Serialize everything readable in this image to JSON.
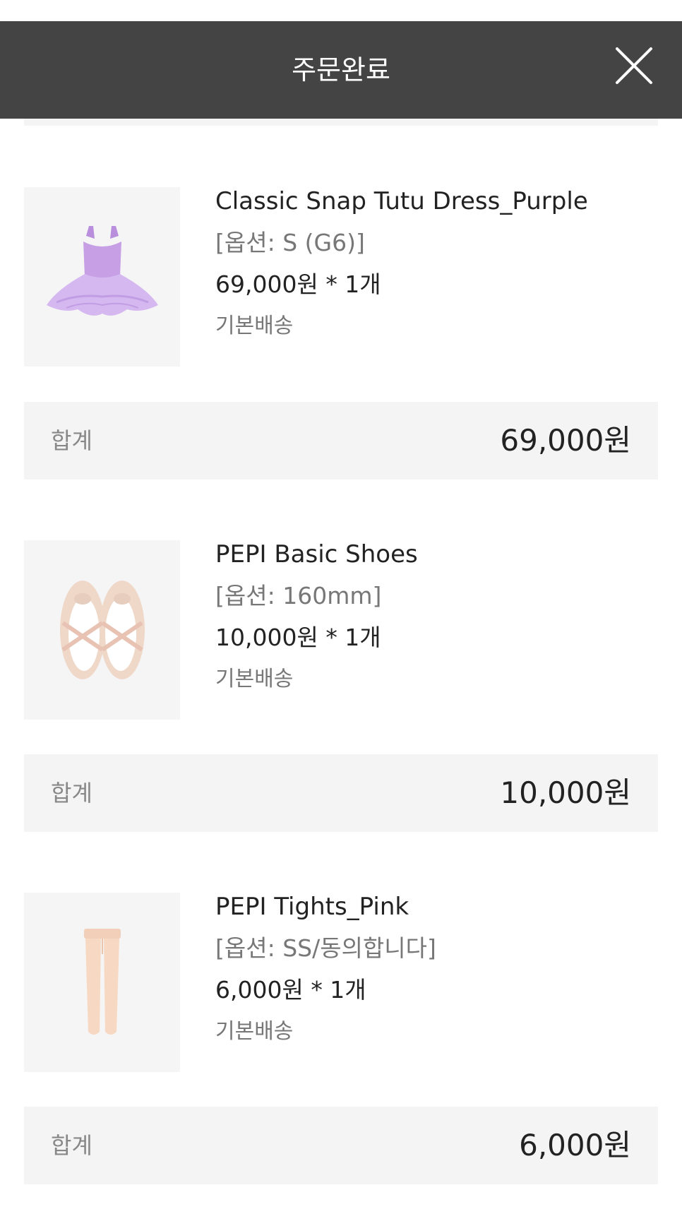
{
  "header": {
    "title": "주문완료",
    "close_icon": "close-icon"
  },
  "orders": [
    {
      "name": "Classic Snap Tutu Dress_Purple",
      "option": "[옵션: S (G6)]",
      "price_qty": "69,000원 * 1개",
      "shipping": "기본배송",
      "image": "tutu-dress-image",
      "total_label": "합계",
      "total_value": "69,000원"
    },
    {
      "name": "PEPI Basic Shoes",
      "option": "[옵션: 160mm]",
      "price_qty": "10,000원 * 1개",
      "shipping": "기본배송",
      "image": "ballet-shoes-image",
      "total_label": "합계",
      "total_value": "10,000원"
    },
    {
      "name": "PEPI Tights_Pink",
      "option": "[옵션: SS/동의합니다]",
      "price_qty": "6,000원 * 1개",
      "shipping": "기본배송",
      "image": "tights-image",
      "total_label": "합계",
      "total_value": "6,000원"
    }
  ],
  "colors": {
    "header_bg": "#444444",
    "panel_bg": "#f4f4f4",
    "thumb_bg": "#f5f5f5",
    "tutu": "#c9a3e6",
    "shoes": "#efd9cc",
    "tights": "#f7d8c2"
  }
}
